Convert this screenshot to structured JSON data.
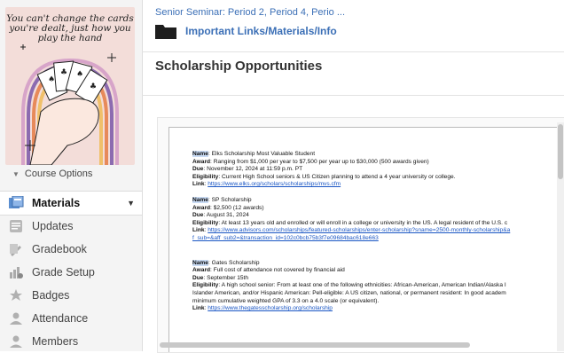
{
  "colors": {
    "link": "#3b6fb6",
    "highlight": "#c9dbf4",
    "doc_link": "#1a56c4"
  },
  "sidebar": {
    "cover_text": "You can't change the cards you're dealt, just how you play the hand",
    "course_options": "Course Options",
    "items": [
      {
        "label": "Materials",
        "icon": "materials-icon",
        "active": true
      },
      {
        "label": "Updates",
        "icon": "updates-icon"
      },
      {
        "label": "Gradebook",
        "icon": "gradebook-icon"
      },
      {
        "label": "Grade Setup",
        "icon": "grade-setup-icon"
      },
      {
        "label": "Badges",
        "icon": "badges-icon"
      },
      {
        "label": "Attendance",
        "icon": "attendance-icon"
      },
      {
        "label": "Members",
        "icon": "members-icon"
      }
    ]
  },
  "header": {
    "breadcrumb": "Senior Seminar: Period 2, Period 4, Perio ...",
    "folder_title": "Important Links/Materials/Info",
    "page_title": "Scholarship Opportunities"
  },
  "doc": {
    "b1": {
      "name_label": "Name",
      "name": ": Elks Scholarship Most Valuable Student",
      "award_label": "Award",
      "award": ": Ranging from $1,000 per year to $7,500 per year up to $30,000 (500 awards given)",
      "due_label": "Due",
      "due": ": November 12, 2024 at 11:59 p.m. PT",
      "elig_label": "Eligibility",
      "elig": ": Current High School seniors & US Citizen planning to attend a 4 year university or college.",
      "link_label": "Link",
      "link": "https://www.elks.org/scholars/scholarships/mvs.cfm"
    },
    "b2": {
      "name_label": "Name",
      "name": ": SP Scholarship",
      "award_label": "Award",
      "award": ": $2,500 (12 awards)",
      "due_label": "Due",
      "due": ": August 31, 2024",
      "elig_label": "Eligibility",
      "elig": ": At least 13 years old and enrolled or will enroll in a college or university in the US. A legal resident of the U.S. c",
      "link_label": "Link",
      "link": "https://www.advisors.com/scholarships/featured-scholarships/enter-scholarship?sname=2500-monthly-scholarship&a",
      "link2": "f_sub=&aff_sub2=&transaction_id=102c0bcb75b3f7e09684bac618e663"
    },
    "b3": {
      "name_label": "Name",
      "name": ": Gates Scholarship",
      "award_label": "Award",
      "award": ": Full cost of attendance not covered by financial aid",
      "due_label": "Due",
      "due": ": September 15th",
      "elig_label": "Eligibility",
      "elig": ": A high school senior: From at least one of the following ethnicities: African-American, American Indian/Alaska I",
      "elig2": "Islander American, and/or Hispanic American: Pell-eligible: A US citizen, national, or permanent resident: In good academ",
      "elig3": "minimum cumulative weighted GPA of 3.3 on a 4.0 scale (or equivalent).",
      "link_label": "Link",
      "link": "https://www.thegatesscholarship.org/scholarship"
    }
  }
}
